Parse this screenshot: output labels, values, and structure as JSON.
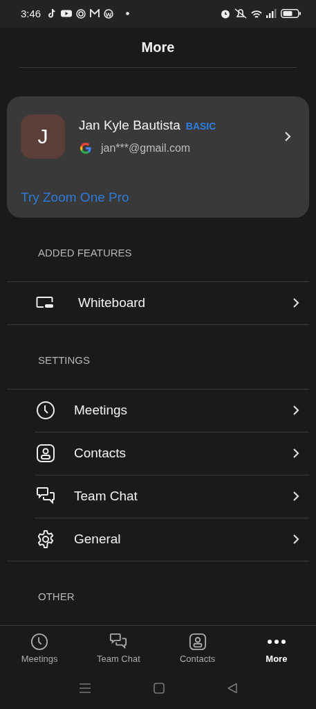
{
  "status_bar": {
    "time": "3:46"
  },
  "header": {
    "title": "More"
  },
  "profile": {
    "initial": "J",
    "name": "Jan Kyle Bautista",
    "plan": "BASIC",
    "email": "jan***@gmail.com",
    "upgrade_link": "Try Zoom One Pro"
  },
  "sections": [
    {
      "title": "ADDED FEATURES",
      "items": [
        {
          "label": "Whiteboard"
        }
      ]
    },
    {
      "title": "SETTINGS",
      "items": [
        {
          "label": "Meetings"
        },
        {
          "label": "Contacts"
        },
        {
          "label": "Team Chat"
        },
        {
          "label": "General"
        }
      ]
    },
    {
      "title": "OTHER"
    }
  ],
  "tabs": [
    {
      "label": "Meetings",
      "selected": false
    },
    {
      "label": "Team Chat",
      "selected": false
    },
    {
      "label": "Contacts",
      "selected": false
    },
    {
      "label": "More",
      "selected": true
    }
  ]
}
